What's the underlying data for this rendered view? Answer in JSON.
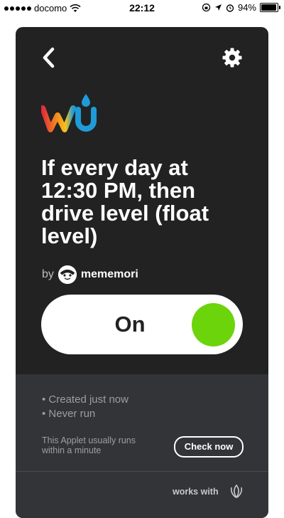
{
  "status_bar": {
    "carrier": "docomo",
    "time": "22:12",
    "battery": "94%",
    "battery_level": 0.94
  },
  "applet": {
    "service_logo": "wu",
    "title": "If every day at 12:30 PM, then drive level (float level)",
    "by_label": "by",
    "author": "mememori",
    "toggle_label": "On",
    "toggle_on": true,
    "status_items": [
      "• Created just now",
      "• Never run"
    ],
    "run_note": "This Applet usually runs within a minute",
    "check_button": "Check now",
    "works_with": "works with"
  },
  "colors": {
    "card_bg": "#222223",
    "lower_bg": "#333437",
    "toggle_knob": "#6bd40b"
  },
  "icons": [
    "back-chevron-icon",
    "gear-icon",
    "weather-underground-logo",
    "avatar-icon",
    "works-with-icon"
  ]
}
